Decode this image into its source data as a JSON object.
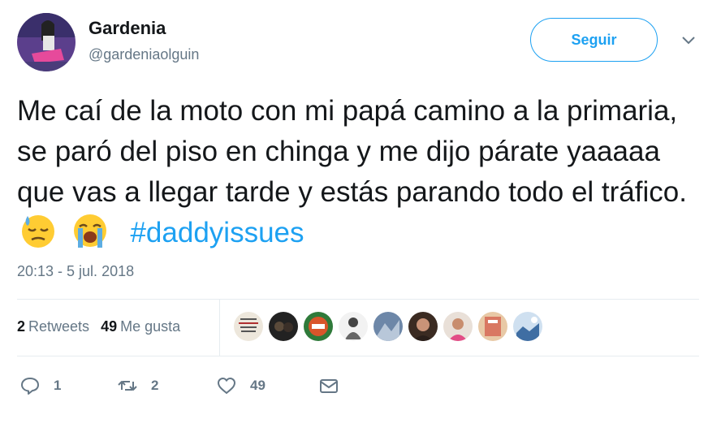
{
  "author": {
    "name": "Gardenia",
    "handle": "@gardeniaolguin"
  },
  "follow_label": "Seguir",
  "tweet": {
    "text": "Me caí de la moto con mi papá camino a la primaria, se paró del piso en chinga y me dijo párate yaaaaa que vas a llegar tarde y estás parando todo el tráfico.",
    "emojis": [
      "downcast-sweat-face-emoji",
      "loudly-crying-face-emoji"
    ],
    "hashtag": "#daddyissues",
    "timestamp": "20:13 - 5 jul. 2018"
  },
  "stats": {
    "retweets_count": "2",
    "retweets_label": "Retweets",
    "likes_count": "49",
    "likes_label": "Me gusta"
  },
  "likers_count_shown": 9,
  "actions": {
    "reply_count": "1",
    "retweet_count": "2",
    "like_count": "49"
  },
  "colors": {
    "accent": "#1da1f2",
    "text": "#14171a",
    "muted": "#657786",
    "divider": "#e6ecf0"
  }
}
